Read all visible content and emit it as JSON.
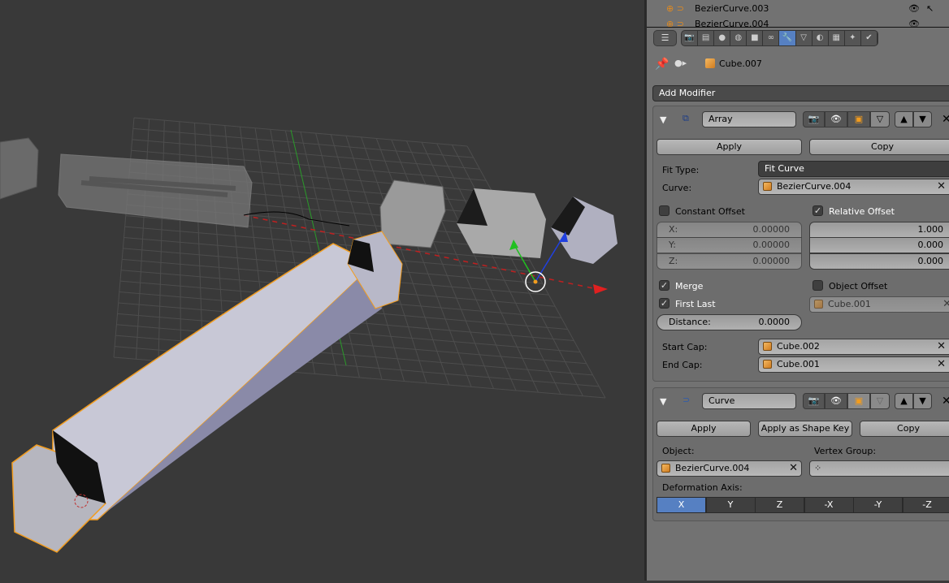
{
  "outliner": {
    "items": [
      {
        "label": "BezierCurve.003"
      },
      {
        "label": "BezierCurve.004"
      }
    ]
  },
  "properties_tabs": {
    "icons": [
      "render-icon",
      "render-layers-icon",
      "scene-icon",
      "world-icon",
      "object-icon",
      "constraints-icon",
      "modifiers-icon",
      "data-icon",
      "material-icon",
      "texture-icon",
      "particles-icon",
      "physics-icon"
    ],
    "active": "modifiers-icon"
  },
  "breadcrumb": {
    "object": "Cube.007"
  },
  "add_modifier": "Add Modifier",
  "array": {
    "name": "Array",
    "apply": "Apply",
    "copy": "Copy",
    "fit_type_label": "Fit Type:",
    "fit_type_value": "Fit Curve",
    "curve_label": "Curve:",
    "curve_value": "BezierCurve.004",
    "constant_offset": {
      "label": "Constant Offset",
      "checked": false,
      "x_label": "X:",
      "x": "0.00000",
      "y_label": "Y:",
      "y": "0.00000",
      "z_label": "Z:",
      "z": "0.00000"
    },
    "relative_offset": {
      "label": "Relative Offset",
      "checked": true,
      "x": "1.000",
      "y": "0.000",
      "z": "0.000"
    },
    "merge": {
      "label": "Merge",
      "checked": true
    },
    "first_last": {
      "label": "First Last",
      "checked": true
    },
    "object_offset": {
      "label": "Object Offset",
      "checked": false,
      "value": "Cube.001"
    },
    "distance_label": "Distance:",
    "distance": "0.0000",
    "start_cap_label": "Start Cap:",
    "start_cap": "Cube.002",
    "end_cap_label": "End Cap:",
    "end_cap": "Cube.001"
  },
  "curve": {
    "name": "Curve",
    "apply": "Apply",
    "apply_shape": "Apply as Shape Key",
    "copy": "Copy",
    "object_label": "Object:",
    "object_value": "BezierCurve.004",
    "vgroup_label": "Vertex Group:",
    "vgroup_value": "",
    "axis_label": "Deformation Axis:",
    "axes": [
      "X",
      "Y",
      "Z",
      "-X",
      "-Y",
      "-Z"
    ],
    "active_axis": "X"
  },
  "colors": {
    "active": "#5680c2",
    "selection": "#f29c1e",
    "x_axis": "#d02020",
    "y_axis": "#20c020",
    "z_axis": "#2040e0"
  }
}
